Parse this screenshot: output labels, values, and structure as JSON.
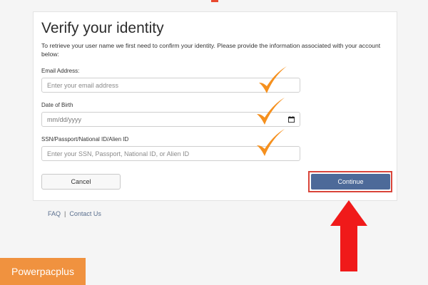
{
  "form": {
    "title": "Verify your identity",
    "intro": "To retrieve your user name we first need to confirm your identity. Please provide the information associated with your account below:",
    "email_label": "Email Address:",
    "email_placeholder": "Enter your email address",
    "dob_label": "Date of Birth",
    "dob_placeholder": "mm/dd/yyyy",
    "id_label": "SSN/Passport/National ID/Alien ID",
    "id_placeholder": "Enter your SSN, Passport, National ID, or Alien ID",
    "cancel_label": "Cancel",
    "continue_label": "Continue"
  },
  "footer": {
    "faq": "FAQ",
    "separator": "|",
    "contact": "Contact Us"
  },
  "watermark": "Powerpacplus",
  "colors": {
    "checkmark": "#f5901e",
    "arrow": "#f01a1a",
    "continue_bg": "#4d6a99",
    "highlight": "#d9453a"
  }
}
